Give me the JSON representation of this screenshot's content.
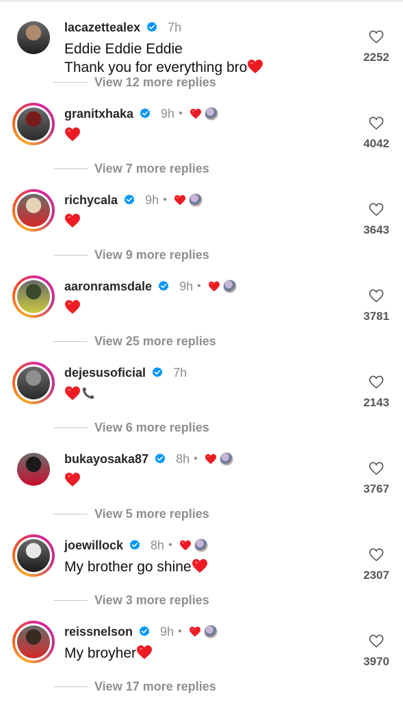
{
  "comments": [
    {
      "username": "lacazettealex",
      "time": "7h",
      "liked_by_author": false,
      "text_lines": [
        "Eddie Eddie Eddie",
        "Thank you for everything bro"
      ],
      "emoji": [
        "heart"
      ],
      "replies": "View 12 more replies",
      "likes": "2252",
      "avatar_ring": false,
      "avatar_colors": [
        "#b08a6e",
        "#1f1f1f"
      ]
    },
    {
      "username": "granitxhaka",
      "time": "9h",
      "liked_by_author": true,
      "text_lines": [
        ""
      ],
      "emoji": [
        "heart"
      ],
      "replies": "View 7 more replies",
      "likes": "4042",
      "avatar_ring": true,
      "avatar_colors": [
        "#7a1b1b",
        "#2b2b2b"
      ]
    },
    {
      "username": "richycala",
      "time": "9h",
      "liked_by_author": true,
      "text_lines": [
        ""
      ],
      "emoji": [
        "heart"
      ],
      "replies": "View 9 more replies",
      "likes": "3643",
      "avatar_ring": true,
      "avatar_colors": [
        "#e5d3b5",
        "#d42a2a"
      ]
    },
    {
      "username": "aaronramsdale",
      "time": "9h",
      "liked_by_author": true,
      "text_lines": [
        ""
      ],
      "emoji": [
        "heart"
      ],
      "replies": "View 25 more replies",
      "likes": "3781",
      "avatar_ring": true,
      "avatar_colors": [
        "#3b4a2a",
        "#c9c940"
      ]
    },
    {
      "username": "dejesusoficial",
      "time": "7h",
      "liked_by_author": false,
      "text_lines": [
        ""
      ],
      "emoji": [
        "heart",
        "phone"
      ],
      "replies": "View 6 more replies",
      "likes": "2143",
      "avatar_ring": true,
      "avatar_colors": [
        "#8f8f8f",
        "#2a2a2a"
      ]
    },
    {
      "username": "bukayosaka87",
      "time": "8h",
      "liked_by_author": true,
      "text_lines": [
        ""
      ],
      "emoji": [
        "heart"
      ],
      "replies": "View 5 more replies",
      "likes": "3767",
      "avatar_ring": false,
      "avatar_colors": [
        "#1a1a1a",
        "#c8102e"
      ]
    },
    {
      "username": "joewillock",
      "time": "8h",
      "liked_by_author": true,
      "text_lines": [
        "My brother go shine"
      ],
      "emoji": [
        "heart"
      ],
      "replies": "View 3 more replies",
      "likes": "2307",
      "avatar_ring": true,
      "avatar_colors": [
        "#e8e8e8",
        "#1a1a1a"
      ]
    },
    {
      "username": "reissnelson",
      "time": "9h",
      "liked_by_author": true,
      "text_lines": [
        "My broyher"
      ],
      "emoji": [
        "heart"
      ],
      "replies": "View 17 more replies",
      "likes": "3970",
      "avatar_ring": true,
      "avatar_colors": [
        "#3a2a22",
        "#d42a2a"
      ]
    }
  ],
  "colors": {
    "verified": "#0095f6",
    "heart": "#ed1c24",
    "muted": "#8e8e8e"
  }
}
